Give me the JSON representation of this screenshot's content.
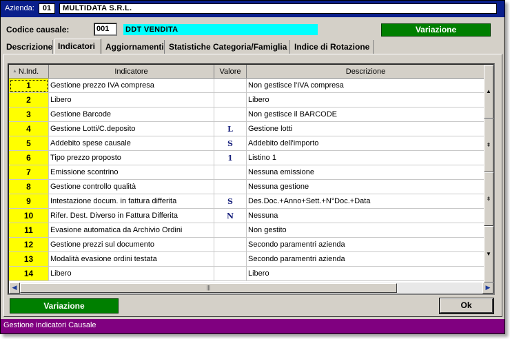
{
  "header": {
    "azienda_label": "Azienda:",
    "azienda_code": "01",
    "azienda_name": "MULTIDATA S.R.L."
  },
  "form": {
    "causale_label": "Codice causale:",
    "causale_code": "001",
    "causale_desc": "DDT VENDITA",
    "variazione_top": "Variazione"
  },
  "tabs": [
    {
      "label": "Descrizione",
      "active": false
    },
    {
      "label": "Indicatori",
      "active": true
    },
    {
      "label": "Aggiornamenti",
      "active": false
    },
    {
      "label": "Statistiche Categoria/Famiglia",
      "active": false
    },
    {
      "label": "Indice di Rotazione",
      "active": false
    }
  ],
  "table": {
    "columns": [
      "N.Ind.",
      "Indicatore",
      "Valore",
      "Descrizione"
    ],
    "rows": [
      {
        "num": "1",
        "indicatore": "Gestione prezzo IVA compresa",
        "valore": "",
        "descrizione": "Non gestisce l'IVA compresa"
      },
      {
        "num": "2",
        "indicatore": "Libero",
        "valore": "",
        "descrizione": "Libero"
      },
      {
        "num": "3",
        "indicatore": "Gestione Barcode",
        "valore": "",
        "descrizione": "Non gestisce il BARCODE"
      },
      {
        "num": "4",
        "indicatore": "Gestione Lotti/C.deposito",
        "valore": "L",
        "descrizione": "Gestione lotti"
      },
      {
        "num": "5",
        "indicatore": "Addebito spese causale",
        "valore": "S",
        "descrizione": "Addebito dell'importo"
      },
      {
        "num": "6",
        "indicatore": "Tipo prezzo proposto",
        "valore": "1",
        "descrizione": "Listino 1"
      },
      {
        "num": "7",
        "indicatore": "Emissione scontrino",
        "valore": "",
        "descrizione": "Nessuna emissione"
      },
      {
        "num": "8",
        "indicatore": "Gestione controllo qualità",
        "valore": "",
        "descrizione": "Nessuna gestione"
      },
      {
        "num": "9",
        "indicatore": "Intestazione docum. in fattura differita",
        "valore": "S",
        "descrizione": "Des.Doc.+Anno+Sett.+N°Doc.+Data"
      },
      {
        "num": "10",
        "indicatore": "Rifer. Dest. Diverso in Fattura Differita",
        "valore": "N",
        "descrizione": "Nessuna"
      },
      {
        "num": "11",
        "indicatore": "Evasione automatica da Archivio Ordini",
        "valore": "",
        "descrizione": "Non gestito"
      },
      {
        "num": "12",
        "indicatore": "Gestione prezzi sul documento",
        "valore": "",
        "descrizione": "Secondo paramentri azienda"
      },
      {
        "num": "13",
        "indicatore": "Modalità evasione ordini testata",
        "valore": "",
        "descrizione": "Secondo paramentri azienda"
      },
      {
        "num": "14",
        "indicatore": "Libero",
        "valore": "",
        "descrizione": "Libero"
      }
    ]
  },
  "buttons": {
    "variazione_bottom": "Variazione",
    "ok": "Ok"
  },
  "status": {
    "text": "Gestione indicatori Causale"
  },
  "colors": {
    "title_bar": "#0a1f8c",
    "status_bar": "#800080",
    "green_button": "#007f00",
    "cyan_field": "#00ffff",
    "yellow_num": "#ffff00"
  }
}
